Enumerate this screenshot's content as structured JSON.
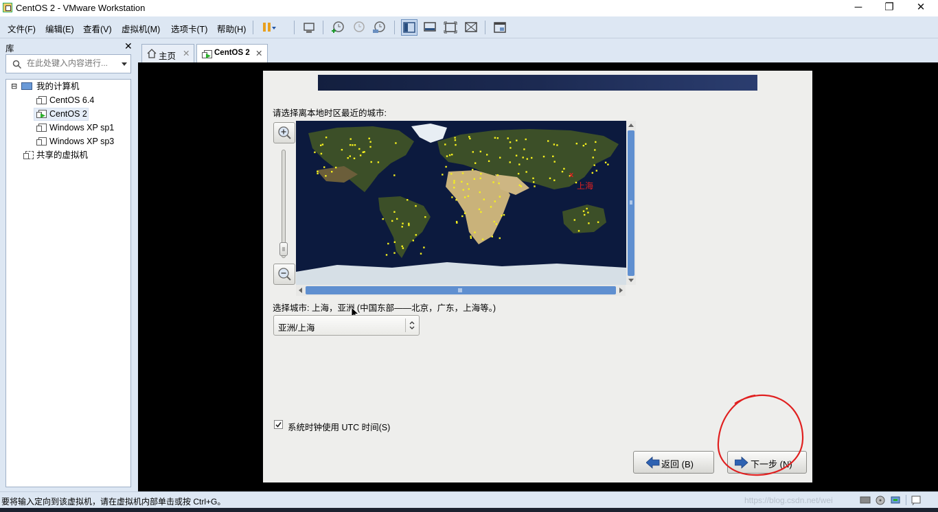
{
  "window": {
    "title": "CentOS 2 - VMware Workstation",
    "minimize": "─",
    "maximize": "❐",
    "close": "✕"
  },
  "menu": [
    "文件(F)",
    "编辑(E)",
    "查看(V)",
    "虚拟机(M)",
    "选项卡(T)",
    "帮助(H)"
  ],
  "library": {
    "title": "库",
    "close": "✕",
    "search_placeholder": "在此处键入内容进行...",
    "my_computer": "我的计算机",
    "vms": [
      "CentOS 6.4",
      "CentOS 2",
      "Windows XP sp1",
      "Windows XP sp3"
    ],
    "shared": "共享的虚拟机",
    "expander": "⊟"
  },
  "tabs": [
    {
      "label": "主页",
      "close": "✕"
    },
    {
      "label": "CentOS 2",
      "close": "✕"
    }
  ],
  "installer": {
    "prompt": "请选择离本地时区最近的城市:",
    "marker": "x",
    "map_city_label": "上海",
    "selected_city_text": "选择城市: 上海，亚洲 (中国东部——北京，广东，上海等。)",
    "timezone_value": "亚洲/上海",
    "utc_label": "系统时钟使用 UTC 时间(S)",
    "back_button": "返回 (B)",
    "next_button": "下一步 (N)"
  },
  "status": {
    "message": "要将输入定向到该虚拟机，请在虚拟机内部单击或按 Ctrl+G。",
    "watermark": "https://blog.csdn.net/wei"
  },
  "colors": {
    "chrome": "#dde7f3",
    "guest_bg": "#eeeeec",
    "city_dot": "#f5f01e",
    "annotation": "#e02020"
  }
}
